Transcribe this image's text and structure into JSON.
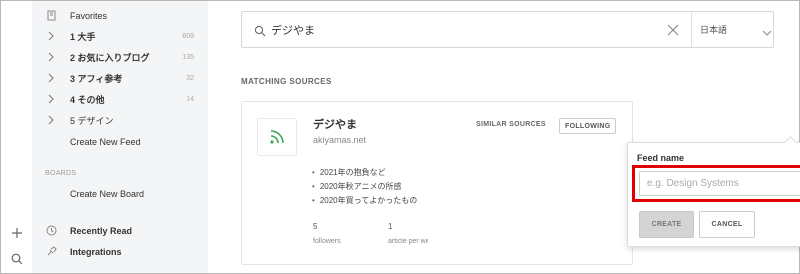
{
  "sidebar": {
    "favorites_label": "Favorites",
    "feeds": [
      {
        "label": "1 大手",
        "count": "609"
      },
      {
        "label": "2 お気に入りブログ",
        "count": "135"
      },
      {
        "label": "3 アフィ参考",
        "count": "32"
      },
      {
        "label": "4 その他",
        "count": "14"
      },
      {
        "label": "5 デザイン",
        "count": ""
      }
    ],
    "create_feed": "Create New Feed",
    "boards_section": "BOARDS",
    "create_board": "Create New Board",
    "recently_read": "Recently Read",
    "integrations": "Integrations"
  },
  "search": {
    "value": "デジやま",
    "language": "日本語"
  },
  "results": {
    "section_title": "MATCHING SOURCES",
    "card": {
      "title": "デジやま",
      "url": "akiyamas.net",
      "similar_label": "SIMILAR SOURCES",
      "following_label": "FOLLOWING",
      "articles": [
        "2021年の抱負など",
        "2020年秋アニメの所感",
        "2020年買ってよかったもの"
      ],
      "followers_count": "5",
      "followers_label": "followers",
      "articles_count": "1",
      "articles_label": "article per week"
    }
  },
  "popover": {
    "feed_name_label": "Feed name",
    "feed_name_value": "",
    "feed_name_placeholder": "e.g. Design Systems",
    "create_label": "CREATE",
    "cancel_label": "CANCEL"
  },
  "colors": {
    "highlight": "#e00000",
    "rss_icon": "#3aa757",
    "sidebar_bg": "#f4f5f6"
  }
}
